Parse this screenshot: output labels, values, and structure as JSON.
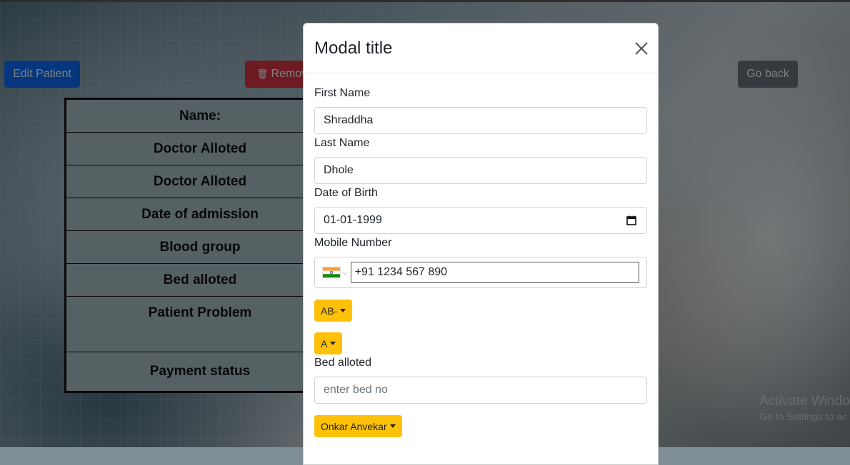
{
  "page": {
    "edit_button": "Edit Patient",
    "remove_button": "Remove",
    "back_button": "Go back",
    "table_rows": [
      "Name:",
      "Doctor Alloted",
      "Doctor Alloted",
      "Date of admission",
      "Blood group",
      "Bed alloted",
      "Patient Problem",
      "Payment status"
    ]
  },
  "modal": {
    "title": "Modal title",
    "fields": {
      "first_name_label": "First Name",
      "first_name_value": "Shraddha",
      "last_name_label": "Last Name",
      "last_name_value": "Dhole",
      "dob_label": "Date of Birth",
      "dob_value": "01-01-1999",
      "mobile_label": "Mobile Number",
      "mobile_value": "+91 1234 567 890",
      "blood_group_dropdown": "AB-",
      "second_dropdown": "A",
      "bed_label": "Bed alloted",
      "bed_placeholder": "enter bed no",
      "doctor_dropdown": "Onkar Anvekar"
    }
  },
  "watermark": {
    "title": "Activate Windo",
    "subtitle": "Go to Settings to ac"
  },
  "colors": {
    "primary": "#0d6efd",
    "danger": "#dc3545",
    "secondary": "#6c757d",
    "warning": "#ffc107"
  }
}
